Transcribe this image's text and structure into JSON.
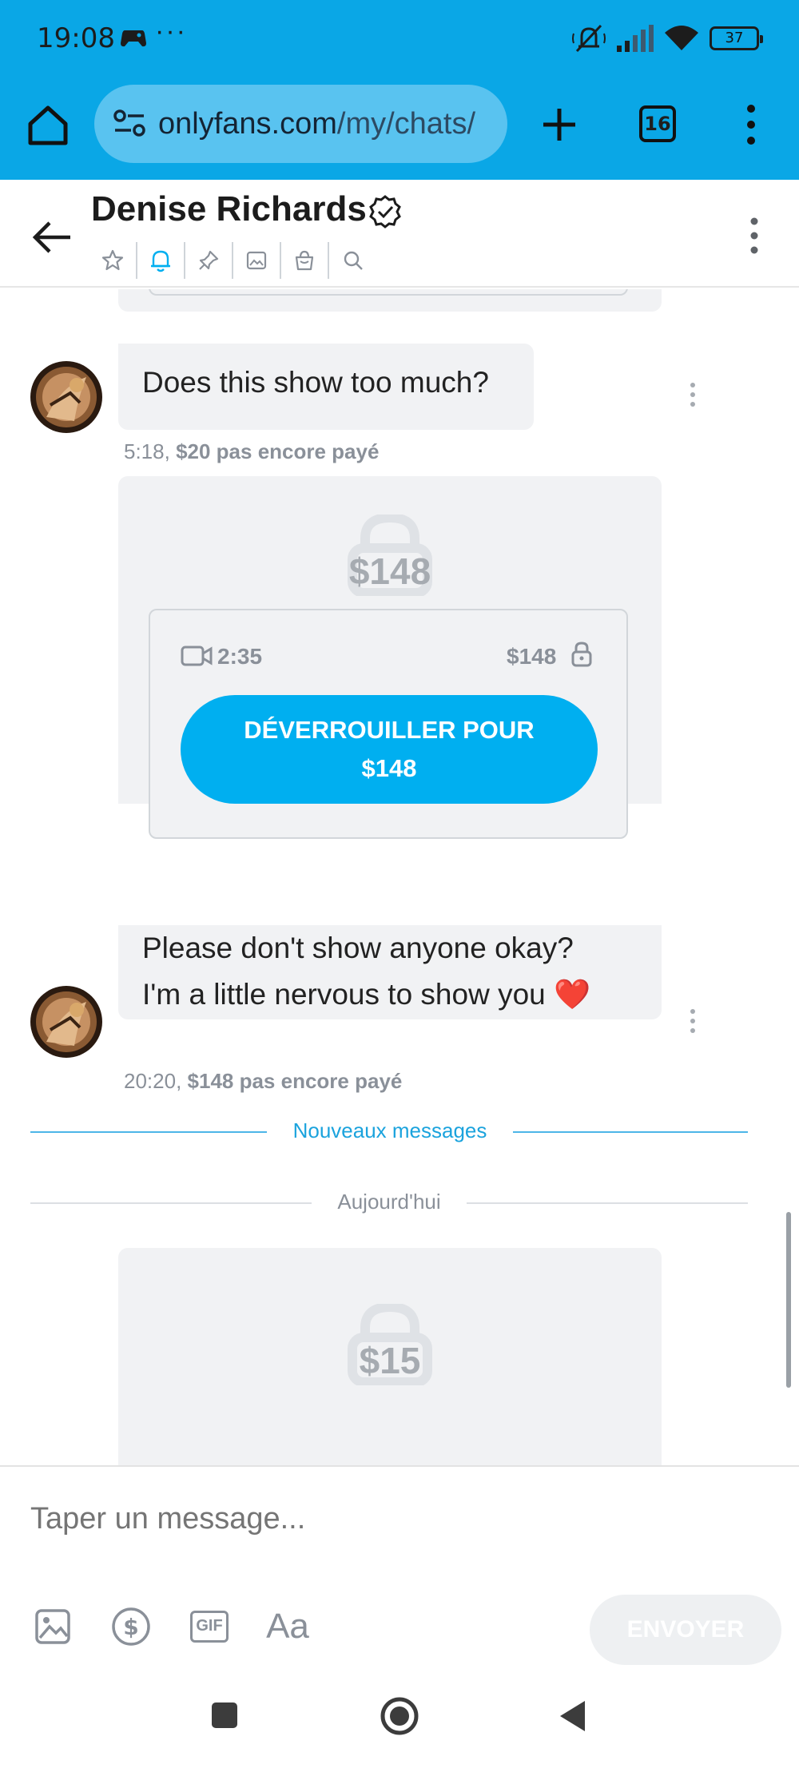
{
  "status_bar": {
    "time": "19:08",
    "dots": "···",
    "battery": "37"
  },
  "browser": {
    "url_domain": "onlyfans.com",
    "url_path": "/my/chats/",
    "tab_count": "16"
  },
  "chat_header": {
    "name": "Denise Richards",
    "tools": [
      "star-icon",
      "bell-icon",
      "pin-icon",
      "image-icon",
      "bag-icon",
      "search-icon"
    ]
  },
  "messages": [
    {
      "text": "Does this show too much?",
      "time": "5:18,",
      "price_status": "$20 pas encore payé"
    },
    {
      "locked_price": "$148",
      "video_duration": "2:35",
      "media_price": "$148",
      "unlock_line1": "DÉVERROUILLER POUR",
      "unlock_line2": "$148",
      "text_line1": "Please don't show anyone okay?",
      "text_line2": "I'm a little nervous to show you",
      "emoji": "❤️",
      "time": "20:20,",
      "price_status": "$148 pas encore payé"
    },
    {
      "locked_price": "$15"
    }
  ],
  "dividers": {
    "new_messages": "Nouveaux messages",
    "today": "Aujourd'hui"
  },
  "composer": {
    "placeholder": "Taper un message...",
    "text_format": "Aa",
    "gif_label": "GIF",
    "send_label": "ENVOYER"
  },
  "colors": {
    "brand": "#00aff0",
    "browser_bar": "#0aa7e6",
    "bubble": "#f1f2f4",
    "meta_text": "#8a9099"
  }
}
